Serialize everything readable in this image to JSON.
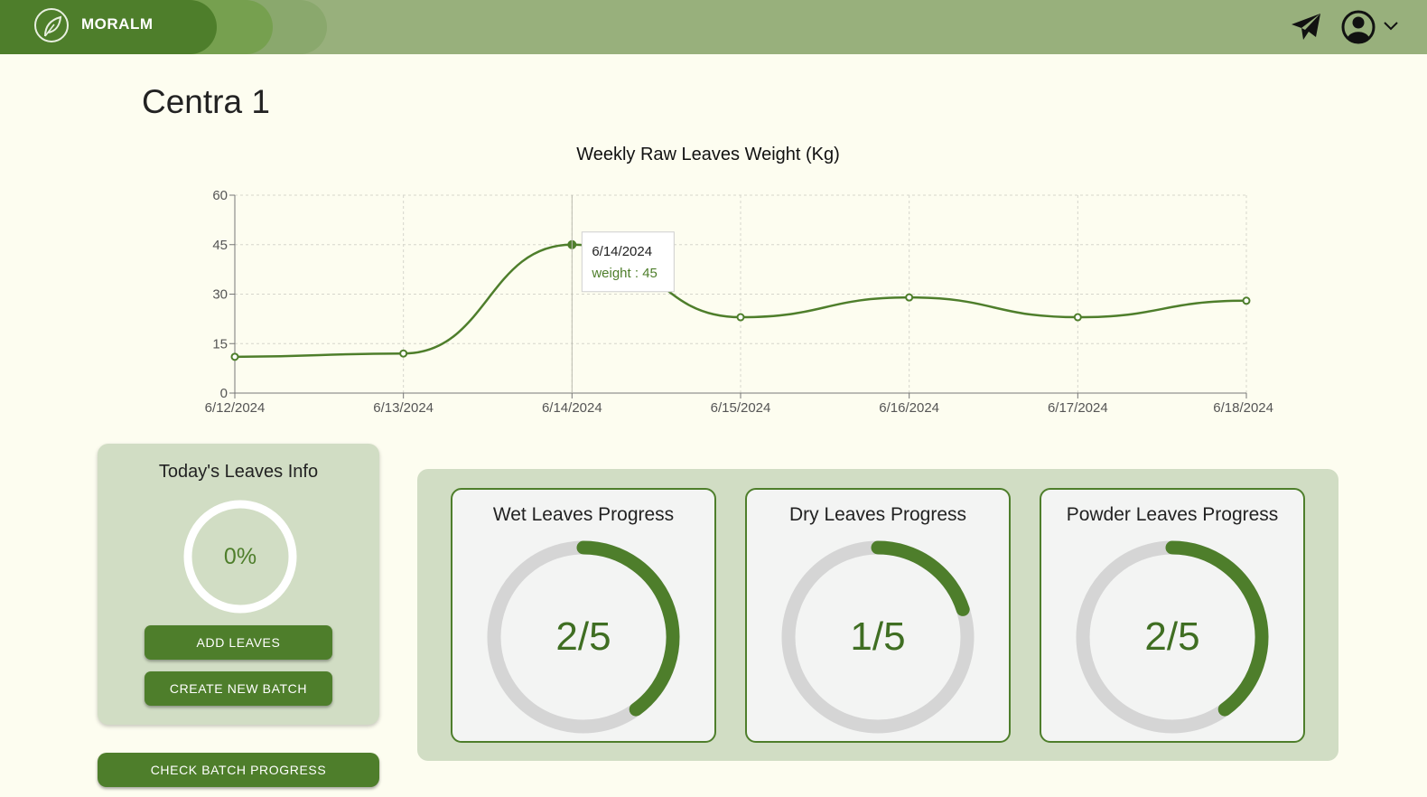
{
  "header": {
    "brand": "MORALM",
    "icons": {
      "logo": "leaf-logo-icon",
      "send": "paper-plane-icon",
      "user": "user-account-icon",
      "chevron": "chevron-down-icon"
    },
    "colors": {
      "brand": "#4e7e2b",
      "bar": "#98b07c"
    }
  },
  "page": {
    "title": "Centra 1"
  },
  "chart_data": {
    "type": "line",
    "title": "Weekly Raw Leaves Weight (Kg)",
    "x": [
      "6/12/2024",
      "6/13/2024",
      "6/14/2024",
      "6/15/2024",
      "6/16/2024",
      "6/17/2024",
      "6/18/2024"
    ],
    "series": [
      {
        "name": "weight",
        "values": [
          11,
          12,
          45,
          23,
          29,
          23,
          28
        ]
      }
    ],
    "ylim": [
      0,
      60
    ],
    "yticks": [
      0,
      15,
      30,
      45,
      60
    ],
    "grid": true,
    "color": "#4e7e2b",
    "tooltip": {
      "date": "6/14/2024",
      "text": "weight : 45"
    }
  },
  "today": {
    "title": "Today's Leaves Info",
    "percent_text": "0%",
    "percent": 0,
    "add_leaves": "ADD LEAVES",
    "create_batch": "CREATE NEW BATCH"
  },
  "check_batch": "CHECK BATCH PROGRESS",
  "progress": [
    {
      "title": "Wet Leaves Progress",
      "value_text": "2/5",
      "value": 2,
      "total": 5
    },
    {
      "title": "Dry Leaves Progress",
      "value_text": "1/5",
      "value": 1,
      "total": 5
    },
    {
      "title": "Powder Leaves Progress",
      "value_text": "2/5",
      "value": 2,
      "total": 5
    }
  ]
}
